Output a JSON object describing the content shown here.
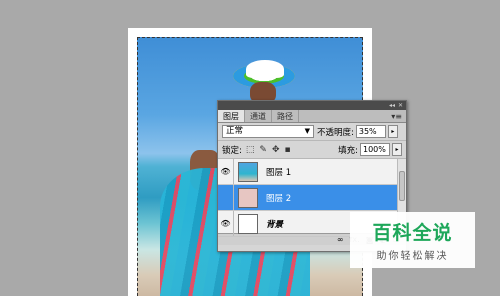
{
  "panel": {
    "tabs": [
      {
        "label": "图层"
      },
      {
        "label": "通道"
      },
      {
        "label": "路径"
      }
    ],
    "blend_mode": "正常",
    "opacity_label": "不透明度:",
    "opacity_value": "35%",
    "lock_label": "锁定:",
    "fill_label": "填充:",
    "fill_value": "100%",
    "layers": [
      {
        "name": "图层 1"
      },
      {
        "name": "图层 2"
      },
      {
        "name": "背景"
      }
    ],
    "selected_layer": "图层 2"
  },
  "watermark": {
    "logo": "百科全说",
    "subtitle": "助你轻松解决"
  },
  "colors": {
    "selection": "#3a8fe8",
    "watermark_green": "#1ea75a"
  }
}
